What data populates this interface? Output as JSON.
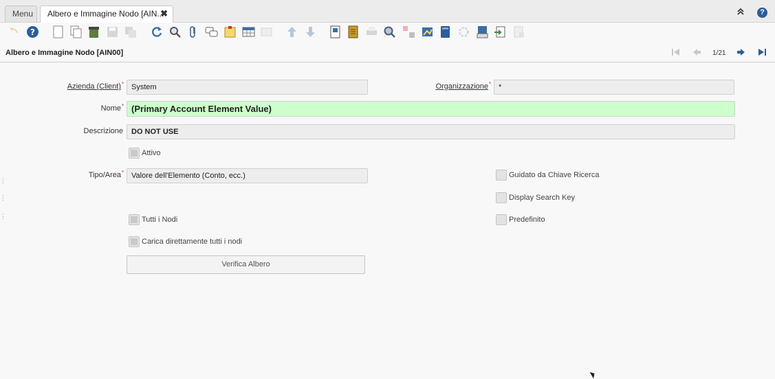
{
  "tabs": {
    "menu_label": "Menu",
    "active_label": "Albero e Immagine Nodo [AIN...",
    "close_glyph": "✖"
  },
  "top_right": {
    "collapse_glyph": "⌃",
    "help_glyph": "?"
  },
  "toolbar": {
    "icons": [
      "undo-icon",
      "help-icon",
      "new-record-icon",
      "copy-record-icon",
      "delete-icon",
      "save-icon",
      "save-new-icon",
      "refresh-icon",
      "find-icon",
      "attachment-icon",
      "chat-icon",
      "post-it-icon",
      "grid-toggle-icon",
      "parent-record-icon",
      "previous-icon",
      "next-icon",
      "report-icon",
      "archive-icon",
      "print-icon",
      "zoom-across-icon",
      "request-icon",
      "product-info-icon",
      "archived-docs-icon",
      "workflow-icon",
      "export-icon",
      "import-icon",
      "customize-icon"
    ]
  },
  "header": {
    "window_title": "Albero e Immagine Nodo [AIN00]",
    "record_count": "1/21"
  },
  "form": {
    "azienda_label": "Azienda (Client)",
    "azienda_value": "System",
    "organizzazione_label": "Organizzazione",
    "organizzazione_value": "*",
    "nome_label": "Nome",
    "nome_value": "(Primary Account Element Value)",
    "descrizione_label": "Descrizione",
    "descrizione_value": "DO NOT USE",
    "attivo_label": "Attivo",
    "tipo_label": "Tipo/Area",
    "tipo_value": "Valore dell'Elemento (Conto, ecc.)",
    "guidato_label": "Guidato da Chiave Ricerca",
    "display_search_key_label": "Display Search Key",
    "tutti_nodi_label": "Tutti i Nodi",
    "predefinito_label": "Predefinito",
    "carica_label": "Carica direttamente tutti i nodi",
    "verifica_button": "Verifica Albero",
    "required_mark": "*"
  },
  "colors": {
    "accent": "#2b5d9c",
    "name_field_bg": "#ccffcc"
  }
}
